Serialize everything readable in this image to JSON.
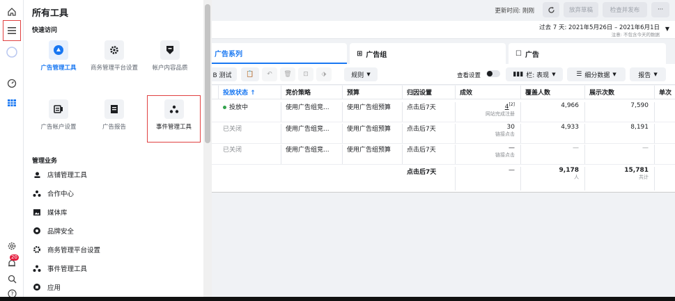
{
  "panel": {
    "title": "所有工具",
    "quick_access_label": "快速访问",
    "quick_tools": [
      {
        "label": "广告管理工具",
        "icon": "ads-manager-icon"
      },
      {
        "label": "商务管理平台设置",
        "icon": "gear-icon"
      },
      {
        "label": "帐户内容品质",
        "icon": "shield-icon"
      },
      {
        "label": "广告帐户设置",
        "icon": "ad-account-icon"
      },
      {
        "label": "广告报告",
        "icon": "report-icon"
      },
      {
        "label": "事件管理工具",
        "icon": "events-manager-icon"
      }
    ],
    "manage_label": "管理业务",
    "business_items": [
      {
        "label": "店铺管理工具",
        "icon": "shop-icon"
      },
      {
        "label": "合作中心",
        "icon": "collab-icon"
      },
      {
        "label": "媒体库",
        "icon": "media-icon"
      },
      {
        "label": "品牌安全",
        "icon": "brand-safety-icon"
      },
      {
        "label": "商务管理平台设置",
        "icon": "gear-icon"
      },
      {
        "label": "事件管理工具",
        "icon": "events-manager-icon"
      },
      {
        "label": "应用",
        "icon": "app-icon"
      }
    ]
  },
  "rail": {
    "notification_count": "20"
  },
  "topbar": {
    "updated": "更新时间: 刚刚",
    "discard_label": "放弃草稿",
    "publish_label": "检查并发布",
    "more_label": "···"
  },
  "datebar": {
    "range": "过去 7 天: 2021年5月26日 – 2021年6月1日",
    "note": "注意: 不包含今天的数据"
  },
  "tabs": {
    "campaigns": "广告系列",
    "adsets": "广告组",
    "ads": "广告"
  },
  "toolbar": {
    "ab_test": "B 测试",
    "rules": "规则",
    "view_settings": "查看设置",
    "columns": "栏: 表现",
    "breakdown": "细分数据",
    "reports": "报告"
  },
  "table": {
    "headers": [
      "投放状态 ↑",
      "竞价策略",
      "预算",
      "归因设置",
      "成效",
      "覆盖人数",
      "展示次数",
      "单次"
    ],
    "rows": [
      {
        "status": "投放中",
        "bid": "使用广告组竞...",
        "budget": "使用广告组预算",
        "attr": "点击后7天",
        "result": "4",
        "result_sup": "[2]",
        "result_sub": "网站完成注册",
        "reach": "4,966",
        "impr": "7,590"
      },
      {
        "status": "已关闭",
        "bid": "使用广告组竞...",
        "budget": "使用广告组预算",
        "attr": "点击后7天",
        "result": "30",
        "result_sup": "",
        "result_sub": "链接点击",
        "reach": "4,933",
        "impr": "8,191"
      },
      {
        "status": "已关闭",
        "bid": "使用广告组竞...",
        "budget": "使用广告组预算",
        "attr": "点击后7天",
        "result": "—",
        "result_sup": "",
        "result_sub": "链接点击",
        "reach": "—",
        "impr": "—"
      }
    ],
    "total": {
      "attr": "点击后7天",
      "result": "—",
      "reach": "9,178",
      "reach_sub": "人",
      "impr": "15,781",
      "impr_sub": "共计"
    }
  },
  "colors": {
    "accent": "#1877f2",
    "active_green": "#31a24c",
    "highlight_red": "#e04040"
  }
}
